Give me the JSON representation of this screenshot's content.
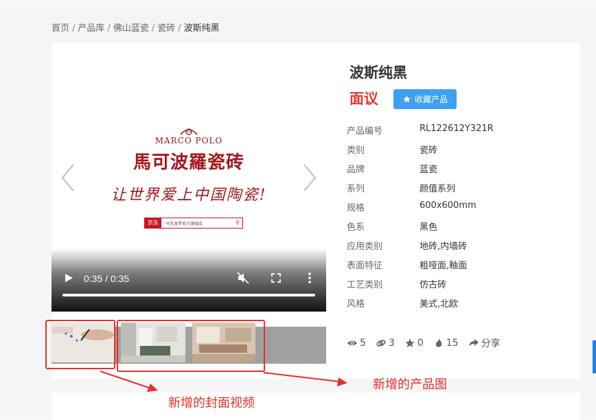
{
  "breadcrumb": {
    "items": [
      "首页",
      "产品库",
      "佛山蓝瓷",
      "瓷砖"
    ],
    "current": "波斯纯黑",
    "separator": "/"
  },
  "product": {
    "title": "波斯纯黑",
    "price": "面议",
    "favorite_label": "收藏产品",
    "specs": [
      {
        "label": "产品编号",
        "value": "RL122612Y321R"
      },
      {
        "label": "类别",
        "value": "瓷砖"
      },
      {
        "label": "品牌",
        "value": "蓝瓷"
      },
      {
        "label": "系列",
        "value": "颜值系列"
      },
      {
        "label": "规格",
        "value": "600x600mm"
      },
      {
        "label": "色系",
        "value": "黑色"
      },
      {
        "label": "应用类别",
        "value": "地砖,内墙砖"
      },
      {
        "label": "表面特征",
        "value": "粗哑面,釉面"
      },
      {
        "label": "工艺类别",
        "value": "仿古砖"
      },
      {
        "label": "风格",
        "value": "美式,北欧"
      }
    ],
    "stats": {
      "views": "5",
      "links": "3",
      "stars": "0",
      "hot": "15",
      "share_label": "分享"
    }
  },
  "video": {
    "brand_en": "MARCO POLO",
    "brand_cn": "馬可波羅瓷砖",
    "slogan": "让世界爱上中国陶瓷!",
    "jd_logo": "京东",
    "jd_text": "马可波罗官方旗舰店",
    "time": "0:35 / 0:35",
    "progress": 1.0
  },
  "annotations": {
    "cover_video": "新增的封面视频",
    "product_images": "新增的产品图"
  },
  "colors": {
    "price": "#e8392e",
    "button": "#3ea0ee",
    "annotation": "#e72f2a",
    "brand_red": "#a3171a"
  }
}
